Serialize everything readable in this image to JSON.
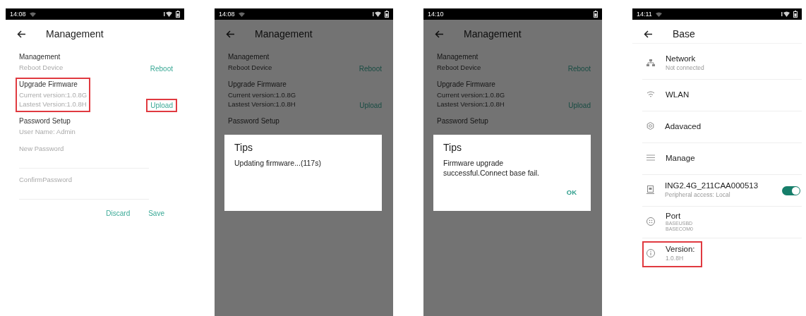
{
  "phones": [
    {
      "kind": "management",
      "status_bar": {
        "time": "14:08",
        "wifi": true,
        "signal": true
      },
      "title": "Management",
      "sections": [
        {
          "title": "Management",
          "lines": [
            "Reboot Device"
          ],
          "action": "Reboot",
          "highlighted": false
        },
        {
          "title": "Upgrade Firmware",
          "lines": [
            "Current version:1.0.8G",
            "Lastest Version:1.0.8H"
          ],
          "action": "Upload",
          "highlighted": true
        },
        {
          "title": "Password Setup",
          "lines": [
            "User Name: Admin"
          ],
          "highlighted": false
        }
      ],
      "fields": [
        {
          "placeholder": "New Password"
        },
        {
          "placeholder": "ConfirmPassword"
        }
      ],
      "buttons": [
        "Discard",
        "Save"
      ]
    },
    {
      "kind": "management",
      "status_bar": {
        "time": "14:08",
        "wifi": true,
        "signal": true
      },
      "title": "Management",
      "sections": [
        {
          "title": "Management",
          "lines": [
            "Reboot Device"
          ],
          "action": "Reboot",
          "highlighted": false
        },
        {
          "title": "Upgrade Firmware",
          "lines": [
            "Current version:1.0.8G",
            "Lastest Version:1.0.8H"
          ],
          "action": "Upload",
          "highlighted": false
        },
        {
          "title": "Password Setup",
          "highlighted": false
        }
      ],
      "dialog": {
        "title": "Tips",
        "message": "Updating firmware...(117s)"
      }
    },
    {
      "kind": "management",
      "status_bar": {
        "time": "14:10",
        "wifi": false,
        "signal": false
      },
      "title": "Management",
      "sections": [
        {
          "title": "Management",
          "lines": [
            "Reboot Device"
          ],
          "action": "Reboot",
          "highlighted": false
        },
        {
          "title": "Upgrade Firmware",
          "lines": [
            "Current version:1.0.8G",
            "Lastest Version:1.0.8H"
          ],
          "action": "Upload",
          "highlighted": false
        },
        {
          "title": "Password Setup",
          "highlighted": false
        }
      ],
      "dialog": {
        "title": "Tips",
        "message": "Firmware upgrade successful.Connect base fail.",
        "button": "OK"
      }
    },
    {
      "kind": "base",
      "status_bar": {
        "time": "14:11",
        "wifi": true,
        "signal": true
      },
      "title": "Base",
      "items": [
        {
          "label": "Network",
          "sub": [
            "Not connected"
          ],
          "kind": "plain",
          "highlighted": false
        },
        {
          "label": "WLAN",
          "kind": "plain",
          "highlighted": false
        },
        {
          "label": "Adavaced",
          "kind": "plain",
          "highlighted": false
        },
        {
          "label": "Manage",
          "kind": "plain",
          "highlighted": false
        },
        {
          "label": "ING2.4G_211CAA000513",
          "sub": [
            "Peripheral access: Local"
          ],
          "kind": "toggle",
          "on": true,
          "highlighted": false
        },
        {
          "label": "Port",
          "sub": [
            "BASEUSBD",
            "BASECOM0"
          ],
          "kind": "plain",
          "highlighted": false
        },
        {
          "label": "Version:",
          "sub": [
            "1.0.8H"
          ],
          "kind": "plain",
          "highlighted": true
        }
      ]
    }
  ]
}
